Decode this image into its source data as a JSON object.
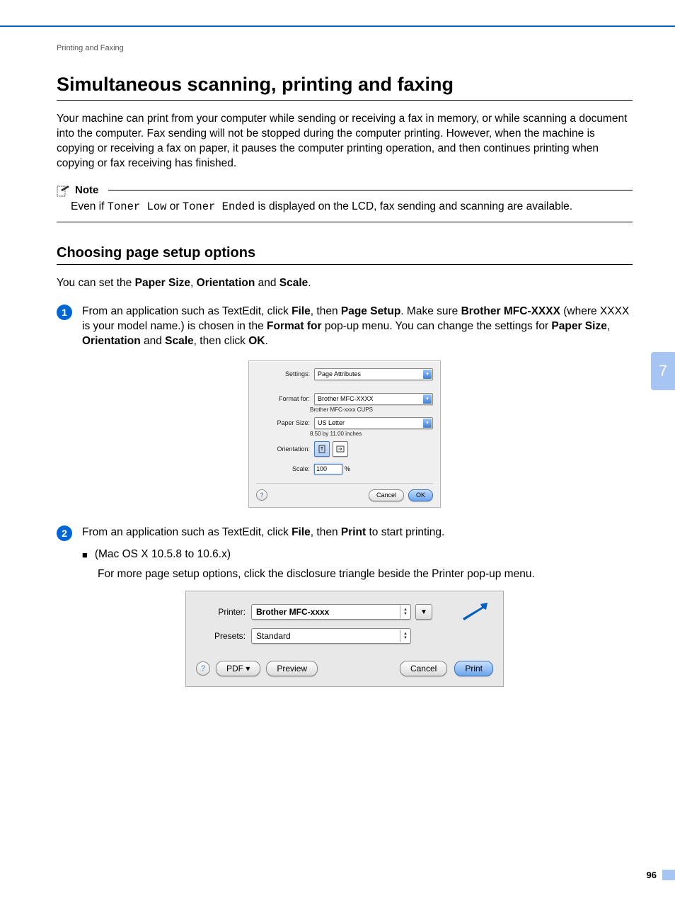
{
  "breadcrumb": "Printing and Faxing",
  "h1": "Simultaneous scanning, printing and faxing",
  "intro": "Your machine can print from your computer while sending or receiving a fax in memory, or while scanning a document into the computer. Fax sending will not be stopped during the computer printing. However, when the machine is copying or receiving a fax on paper, it pauses the computer printing operation, and then continues printing when copying or fax receiving has finished.",
  "note": {
    "label": "Note",
    "pre": "Even if ",
    "code1": "Toner Low",
    "mid1": " or ",
    "code2": "Toner Ended",
    "post": " is displayed on the LCD, fax sending and scanning are available."
  },
  "h2": "Choosing page setup options",
  "h2_intro_pre": "You can set the ",
  "h2_intro_b1": "Paper Size",
  "h2_intro_c1": ", ",
  "h2_intro_b2": "Orientation",
  "h2_intro_c2": " and ",
  "h2_intro_b3": "Scale",
  "h2_intro_post": ".",
  "step1": {
    "num": "1",
    "p1": "From an application such as TextEdit, click ",
    "b1": "File",
    "p2": ", then ",
    "b2": "Page Setup",
    "p3": ". Make sure ",
    "b3": "Brother MFC-XXXX",
    "p4": " (where XXXX is your model name.) is chosen in the ",
    "b4": "Format for",
    "p5": " pop-up menu. You can change the settings for ",
    "b5": "Paper Size",
    "p6": ", ",
    "b6": "Orientation",
    "p7": " and ",
    "b7": "Scale",
    "p8": ", then click ",
    "b8": "OK",
    "p9": "."
  },
  "dlg1": {
    "settings_lbl": "Settings:",
    "settings_val": "Page Attributes",
    "format_lbl": "Format for:",
    "format_val": "Brother MFC-XXXX",
    "format_sub": "Brother MFC-xxxx CUPS",
    "paper_lbl": "Paper Size:",
    "paper_val": "US Letter",
    "paper_sub": "8.50 by 11.00 inches",
    "orient_lbl": "Orientation:",
    "scale_lbl": "Scale:",
    "scale_val": "100",
    "scale_unit": "%",
    "cancel": "Cancel",
    "ok": "OK"
  },
  "step2": {
    "num": "2",
    "p1": "From an application such as TextEdit, click ",
    "b1": "File",
    "p2": ", then ",
    "b2": "Print",
    "p3": " to start printing."
  },
  "bullet_mac": "(Mac OS X 10.5.8 to 10.6.x)",
  "bullet_mac_sub": "For more page setup options, click the disclosure triangle beside the Printer pop-up menu.",
  "dlg2": {
    "printer_lbl": "Printer:",
    "printer_val": "Brother MFC-xxxx",
    "presets_lbl": "Presets:",
    "presets_val": "Standard",
    "pdf": "PDF ▾",
    "preview": "Preview",
    "cancel": "Cancel",
    "print": "Print"
  },
  "side_tab": "7",
  "page_num": "96"
}
